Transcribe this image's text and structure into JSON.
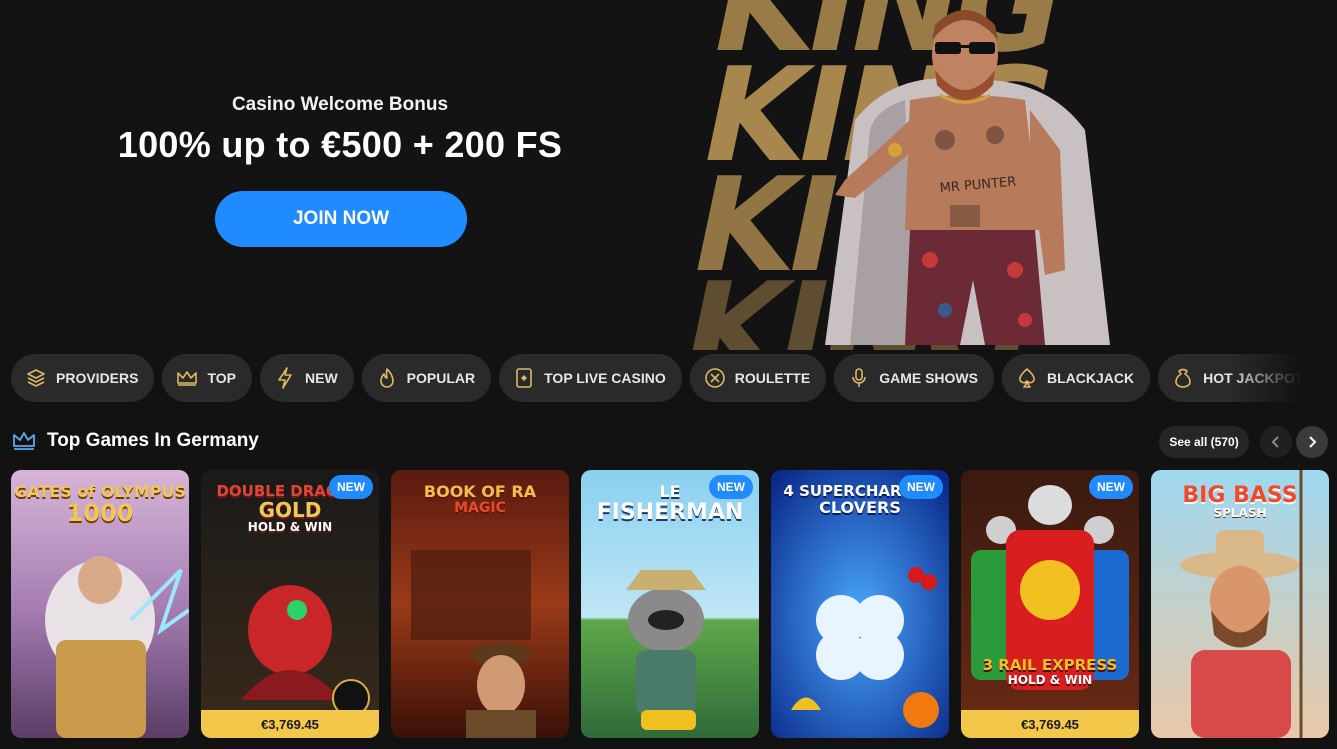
{
  "hero": {
    "subtitle": "Casino Welcome Bonus",
    "title": "100% up to €500 + 200 FS",
    "cta": "JOIN NOW",
    "backdrop_word": "KING",
    "shirt_text": "MR PUNTER"
  },
  "categories": [
    {
      "label": "PROVIDERS",
      "icon": "layers-icon"
    },
    {
      "label": "TOP",
      "icon": "crown-icon"
    },
    {
      "label": "NEW",
      "icon": "lightning-icon"
    },
    {
      "label": "POPULAR",
      "icon": "flame-icon"
    },
    {
      "label": "TOP LIVE CASINO",
      "icon": "card-icon"
    },
    {
      "label": "ROULETTE",
      "icon": "roulette-icon"
    },
    {
      "label": "GAME SHOWS",
      "icon": "microphone-icon"
    },
    {
      "label": "BLACKJACK",
      "icon": "spade-icon"
    },
    {
      "label": "HOT JACKPOTS",
      "icon": "money-bag-icon"
    }
  ],
  "section": {
    "title": "Top Games In Germany",
    "see_all": "See all (570)"
  },
  "games": [
    {
      "title_line1": "GATES of OLYMPUS",
      "title_line2": "1000",
      "is_new": false,
      "jackpot": null
    },
    {
      "title_line1": "DOUBLE DRAGON",
      "title_line2": "GOLD",
      "title_line3": "HOLD & WIN",
      "is_new": true,
      "jackpot": "€3,769.45"
    },
    {
      "title_line1": "BOOK OF RA",
      "title_line2": "MAGIC",
      "is_new": false,
      "jackpot": null
    },
    {
      "title_line1": "LE",
      "title_line2": "FISHERMAN",
      "is_new": true,
      "jackpot": null
    },
    {
      "title_line1": "4 SUPERCHARGED",
      "title_line2": "CLOVERS",
      "is_new": true,
      "jackpot": null
    },
    {
      "title_line1": "3 RAIL EXPRESS",
      "title_line2": "HOLD & WIN",
      "is_new": true,
      "jackpot": "€3,769.45"
    },
    {
      "title_line1": "BIG BASS",
      "title_line2": "SPLASH",
      "is_new": false,
      "jackpot": null
    }
  ],
  "badges": {
    "new": "NEW"
  },
  "colors": {
    "accent": "#1f8bff",
    "jackpot": "#f3c74a",
    "chip_bg": "#2a2a2a",
    "gold": "#a8874e"
  }
}
